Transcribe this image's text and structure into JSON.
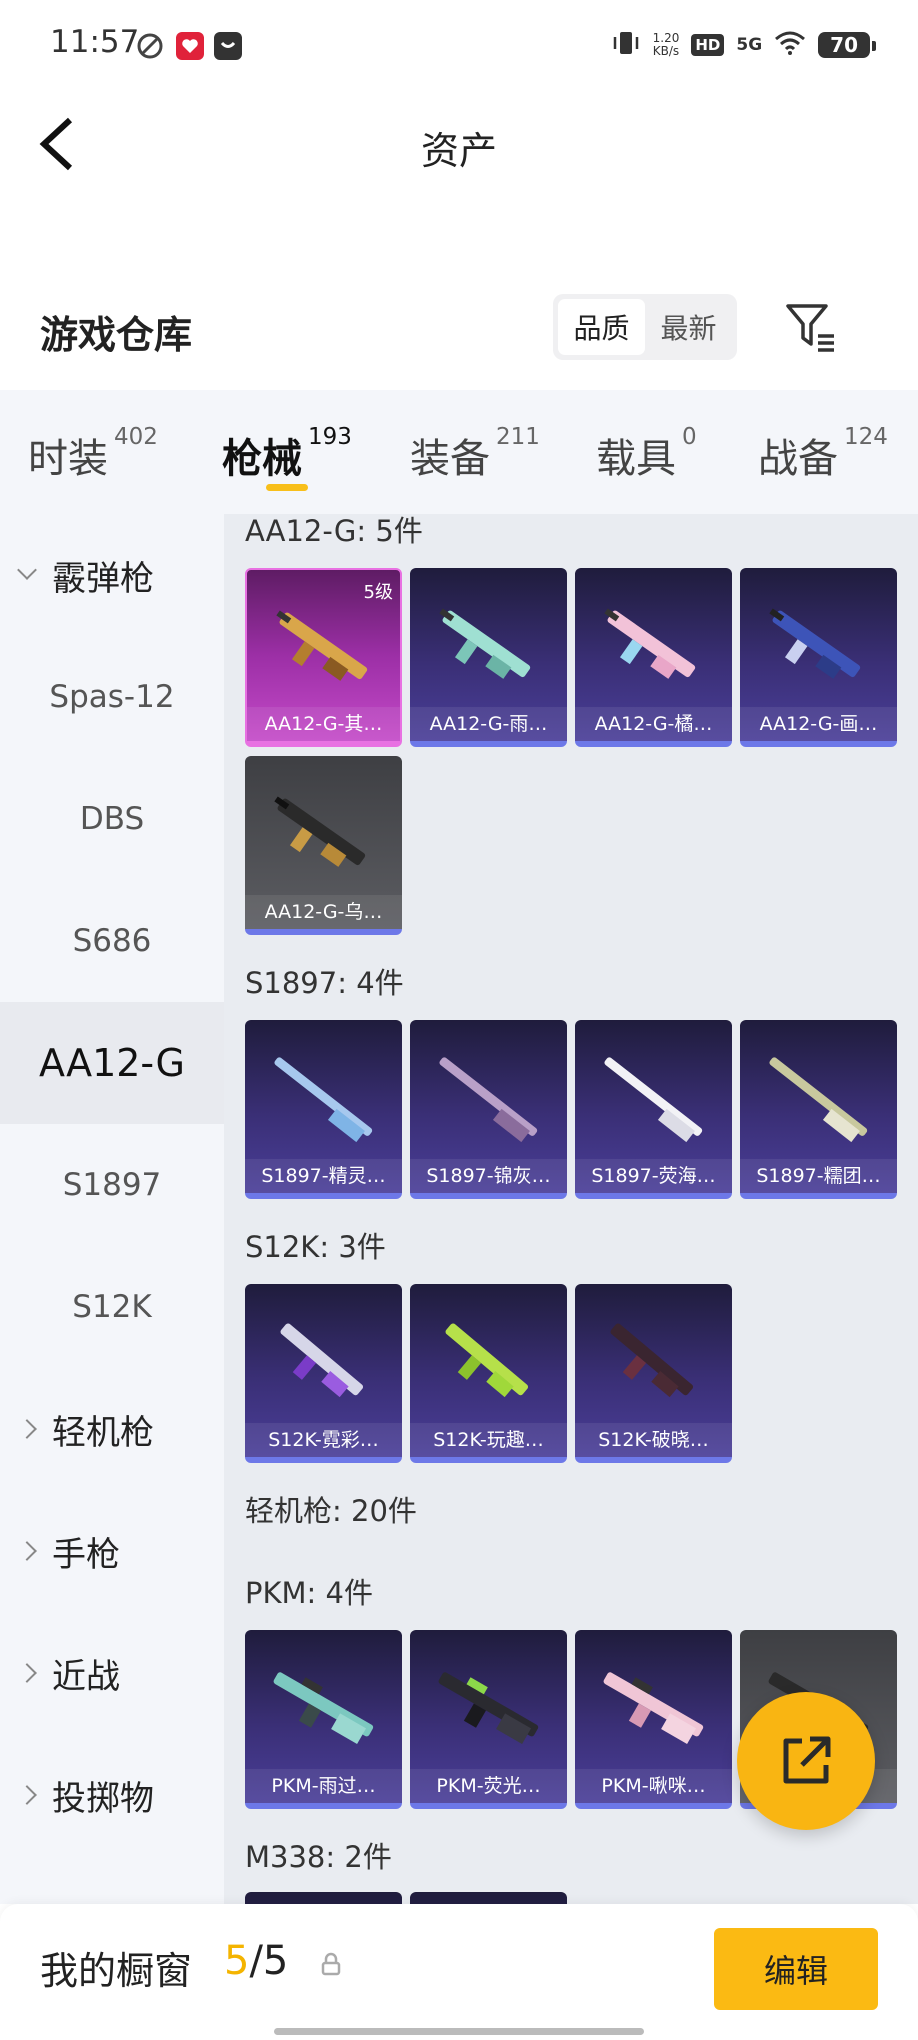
{
  "status_bar": {
    "time": "11:57",
    "net_speed_value": "1.20",
    "net_speed_unit": "KB/s",
    "hd": "HD",
    "network": "5G",
    "battery": "70"
  },
  "nav": {
    "title": "资产",
    "back_icon": "back-arrow-icon"
  },
  "warehouse": {
    "title": "游戏仓库",
    "sort_options": [
      "品质",
      "最新"
    ],
    "sort_selected": "品质",
    "filter_icon": "filter-icon"
  },
  "tabs": [
    {
      "label": "时装",
      "count": "402"
    },
    {
      "label": "枪械",
      "count": "193",
      "active": true
    },
    {
      "label": "装备",
      "count": "211"
    },
    {
      "label": "载具",
      "count": "0"
    },
    {
      "label": "战备",
      "count": "124"
    }
  ],
  "sidebar": [
    {
      "label": "霰弹枪",
      "type": "group",
      "expanded": true
    },
    {
      "label": "Spas-12"
    },
    {
      "label": "DBS"
    },
    {
      "label": "S686"
    },
    {
      "label": "AA12-G",
      "active": true
    },
    {
      "label": "S1897"
    },
    {
      "label": "S12K"
    },
    {
      "label": "轻机枪",
      "type": "group"
    },
    {
      "label": "手枪",
      "type": "group"
    },
    {
      "label": "近战",
      "type": "group"
    },
    {
      "label": "投掷物",
      "type": "group"
    }
  ],
  "sections": [
    {
      "title": "AA12-G: 5件",
      "items": [
        {
          "label": "AA12-G-其…",
          "badge": "5级",
          "rarity": "pink"
        },
        {
          "label": "AA12-G-雨…"
        },
        {
          "label": "AA12-G-橘…"
        },
        {
          "label": "AA12-G-画…"
        },
        {
          "label": "AA12-G-乌…",
          "rarity": "gray"
        }
      ]
    },
    {
      "title": "S1897: 4件",
      "items": [
        {
          "label": "S1897-精灵…"
        },
        {
          "label": "S1897-锦灰…"
        },
        {
          "label": "S1897-荧海…"
        },
        {
          "label": "S1897-糯团…"
        }
      ]
    },
    {
      "title": "S12K: 3件",
      "items": [
        {
          "label": "S12K-霓彩…"
        },
        {
          "label": "S12K-玩趣…"
        },
        {
          "label": "S12K-破晓…"
        }
      ]
    },
    {
      "title": "轻机枪: 20件"
    },
    {
      "title": "PKM: 4件",
      "items": [
        {
          "label": "PKM-雨过…"
        },
        {
          "label": "PKM-荧光…"
        },
        {
          "label": "PKM-啾咪…"
        },
        {
          "label": "…",
          "rarity": "gray"
        }
      ]
    },
    {
      "title": "M338: 2件"
    }
  ],
  "bottom_bar": {
    "label": "我的橱窗",
    "count_current": "5",
    "count_total": "/5",
    "lock_icon": "lock-icon",
    "edit_label": "编辑"
  },
  "fab": {
    "icon": "share-external-icon"
  },
  "colors": {
    "accent": "#fbba13",
    "epic_card": "#4a3e98",
    "legend_card": "#c44ac8",
    "common_card": "#5c5d62"
  }
}
